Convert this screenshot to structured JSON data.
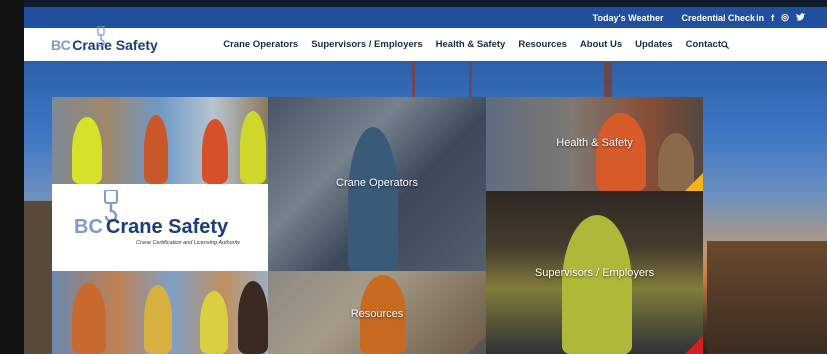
{
  "topbar": {
    "links": [
      "Today's Weather",
      "Credential Check"
    ],
    "social": [
      {
        "icon": "linkedin-icon",
        "glyph": "in"
      },
      {
        "icon": "facebook-icon",
        "glyph": "f"
      },
      {
        "icon": "instagram-icon",
        "glyph": "◎"
      },
      {
        "icon": "twitter-icon",
        "glyph": "🐦"
      }
    ]
  },
  "logo": {
    "bc": "BC",
    "name": "Crane Safety"
  },
  "nav": {
    "items": [
      "Crane Operators",
      "Supervisors / Employers",
      "Health & Safety",
      "Resources",
      "About Us",
      "Updates",
      "Contact"
    ]
  },
  "tiles": {
    "crane_operators": "Crane Operators",
    "health_safety": "Health & Safety",
    "supervisors": "Supervisors / Employers",
    "resources": "Resources",
    "logo_bc": "BC",
    "logo_name": "Crane Safety",
    "logo_tagline": "Crane Certification and Licensing Authority"
  },
  "colors": {
    "topbar": "#1f4f9e",
    "nav_text": "#1d2a44",
    "brand_dark": "#1b3d7a",
    "brand_light": "#7e9cc7",
    "accent_yellow": "#f2b51b",
    "accent_red": "#d31f26"
  }
}
